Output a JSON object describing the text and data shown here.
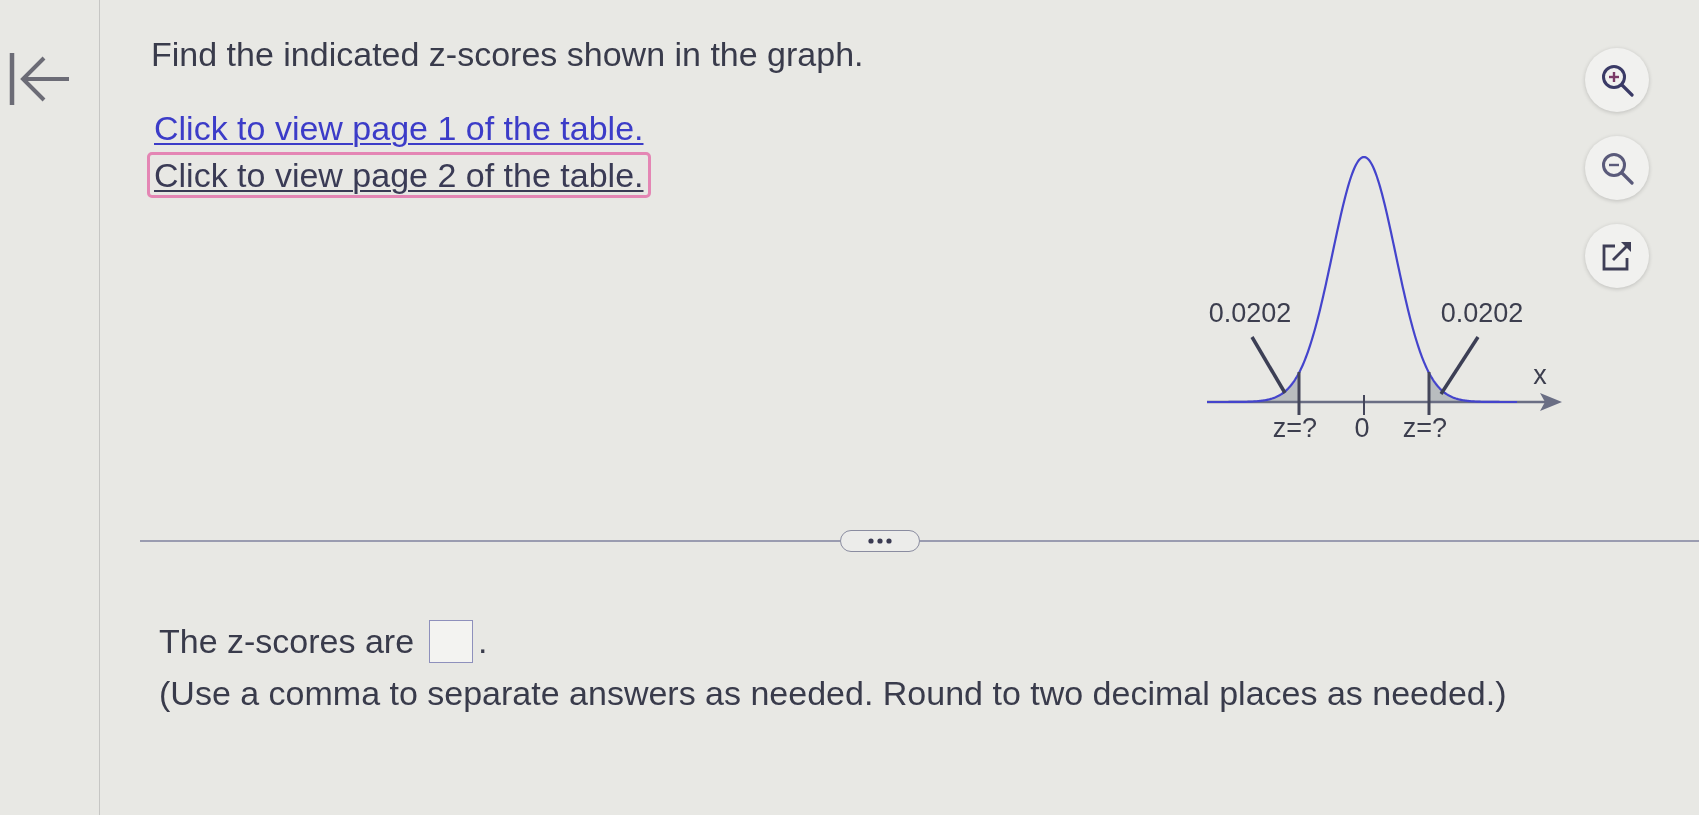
{
  "question": {
    "prompt": "Find the indicated z-scores shown in the graph.",
    "links": [
      {
        "text": "Click to view page 1 of the table.",
        "focused": false
      },
      {
        "text": "Click to view page 2 of the table.",
        "focused": true
      }
    ]
  },
  "graph": {
    "tail_labels": [
      "0.0202",
      "0.0202"
    ],
    "axis_label": "x",
    "tick_labels": [
      "z=?",
      "0",
      "z=?"
    ]
  },
  "answer": {
    "lead": "The z-scores are",
    "end": ".",
    "note": "(Use a comma to separate answers as needed. Round to two decimal places as needed.)"
  }
}
